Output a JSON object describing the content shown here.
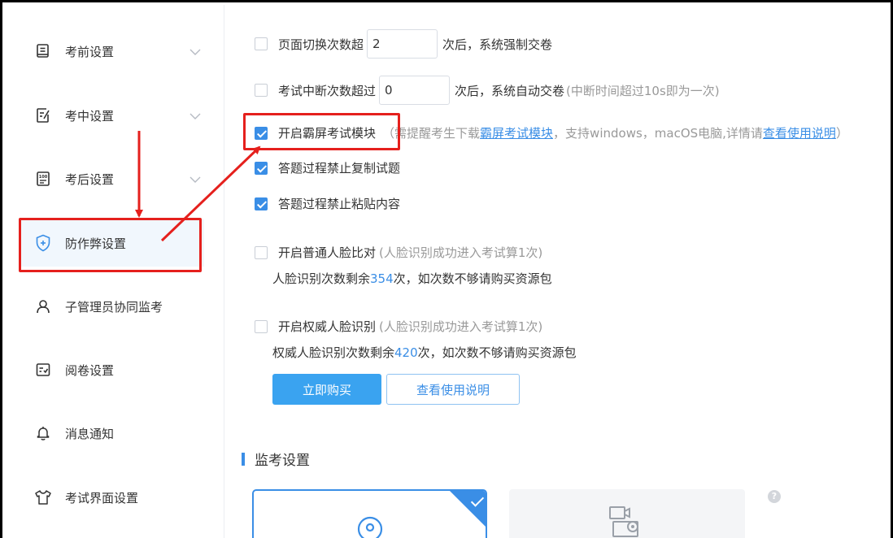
{
  "sidebar": {
    "items": [
      {
        "label": "考前设置",
        "icon": "book-icon",
        "has_chevron": true
      },
      {
        "label": "考中设置",
        "icon": "edit-document-icon",
        "has_chevron": true
      },
      {
        "label": "考后设置",
        "icon": "score-report-icon",
        "has_chevron": true
      },
      {
        "label": "防作弊设置",
        "icon": "shield-icon",
        "active": true
      },
      {
        "label": "子管理员协同监考",
        "icon": "user-icon"
      },
      {
        "label": "阅卷设置",
        "icon": "checklist-icon"
      },
      {
        "label": "消息通知",
        "icon": "bell-icon"
      },
      {
        "label": "考试界面设置",
        "icon": "shirt-icon"
      }
    ]
  },
  "settings": {
    "page_switch": {
      "checked": false,
      "label": "页面切换次数超",
      "value": "2",
      "suffix": "次后，系统强制交卷"
    },
    "interrupt": {
      "checked": false,
      "label": "考试中断次数超过",
      "value": "0",
      "suffix": "次后，系统自动交卷",
      "hint": "(中断时间超过10s即为一次)"
    },
    "lockdown": {
      "checked": true,
      "label": "开启霸屏考试模块",
      "hint_prefix": "（需提醒考生下载",
      "hint_link": "霸屏考试模块",
      "hint_middle": "，支持windows，macOS电脑,详情请",
      "hint_link2": "查看使用说明",
      "hint_suffix": "）"
    },
    "no_copy": {
      "checked": true,
      "label": "答题过程禁止复制试题"
    },
    "no_paste": {
      "checked": true,
      "label": "答题过程禁止粘贴内容"
    },
    "face_compare": {
      "checked": false,
      "label": "开启普通人脸比对",
      "hint": "(人脸识别成功进入考试算1次)",
      "remaining_prefix": "人脸识别次数剩余",
      "remaining_count": "354",
      "remaining_suffix": "次，如次数不够请购买资源包"
    },
    "auth_face": {
      "checked": false,
      "label": "开启权威人脸识别",
      "hint": "(人脸识别成功进入考试算1次)",
      "remaining_prefix": "权威人脸识别次数剩余",
      "remaining_count": "420",
      "remaining_suffix": "次，如次数不够请购买资源包"
    },
    "buy_button": "立即购买",
    "guide_button": "查看使用说明"
  },
  "proctor": {
    "title": "监考设置",
    "help_icon_text": "?"
  },
  "colors": {
    "accent": "#3a8ee6",
    "annotation": "#e5201d",
    "button": "#3aa3f0"
  }
}
